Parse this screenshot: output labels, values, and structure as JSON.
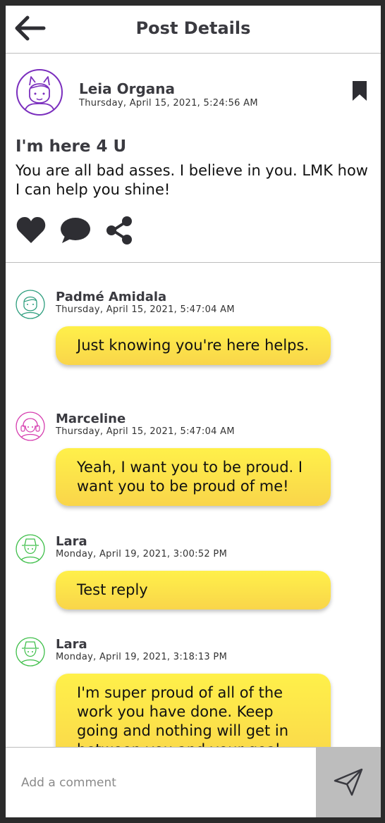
{
  "header": {
    "title": "Post Details",
    "back_icon": "arrow-left-icon"
  },
  "post": {
    "author": "Leia Organa",
    "timestamp": "Thursday, April 15, 2021, 5:24:56 AM",
    "title": "I'm here 4 U",
    "body": "You are all bad asses. I believe in you. LMK how I can help you shine!",
    "avatar_color": "#7b2fbe",
    "actions": [
      "heart-icon",
      "comment-icon",
      "share-icon"
    ],
    "bookmark_icon": "bookmark-icon"
  },
  "comments": [
    {
      "name": "Padmé Amidala",
      "timestamp": "Thursday, April 15, 2021, 5:47:04 AM",
      "text": "Just knowing you're here helps.",
      "avatar_color": "#2e9e7e"
    },
    {
      "name": "Marceline",
      "timestamp": "Thursday, April 15, 2021, 5:47:04 AM",
      "text": "Yeah, I want you to be proud. I want you to be proud of me!",
      "avatar_color": "#d63fb0"
    },
    {
      "name": "Lara",
      "timestamp": "Monday, April 19, 2021, 3:00:52 PM",
      "text": "Test reply",
      "avatar_color": "#3fbf4a"
    },
    {
      "name": "Lara",
      "timestamp": "Monday, April 19, 2021, 3:18:13 PM",
      "text": "I'm super proud of all of the work you have done. Keep going and nothing will get in between you and your goal.",
      "avatar_color": "#3fbf4a"
    }
  ],
  "composer": {
    "placeholder": "Add a comment",
    "send_icon": "send-icon"
  },
  "colors": {
    "bubble_top": "#fff04a",
    "bubble_bottom": "#f9d54a",
    "text_dark": "#3a3a40",
    "send_bg": "#bdbdbd"
  }
}
